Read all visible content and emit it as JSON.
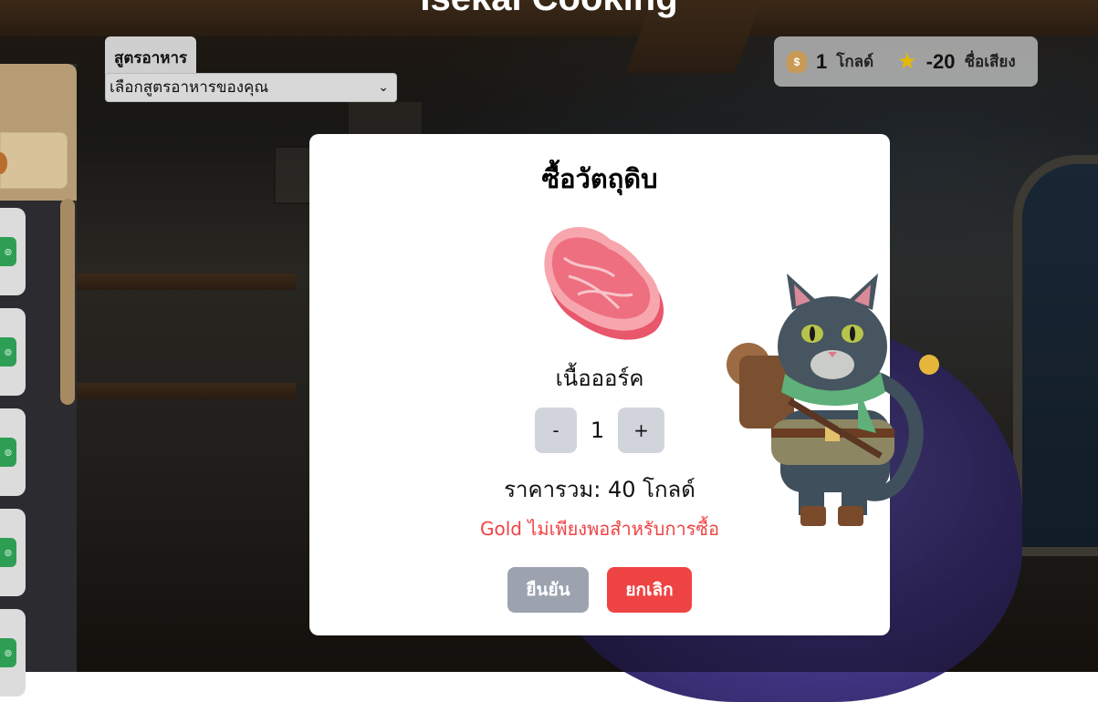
{
  "game_title": "Isekai Cooking",
  "recipe": {
    "label": "สูตรอาหาร",
    "selected": "เลือกสูตรอาหารของคุณ"
  },
  "stats": {
    "gold_value": "1",
    "gold_unit": "โกลด์",
    "gold_icon": "money-bag-icon",
    "reputation_value": "-20",
    "reputation_unit": "ชื่อเสียง",
    "reputation_icon": "star-icon"
  },
  "sidebar": {
    "card_buttons": [
      "๏",
      "๏",
      "๏",
      "๏",
      "๏"
    ]
  },
  "modal": {
    "title": "ซื้อวัตถุดิบ",
    "item_name": "เนื้อออร์ค",
    "item_icon": "meat-steak-icon",
    "minus_label": "-",
    "quantity": "1",
    "plus_label": "+",
    "total": "ราคารวม: 40 โกลด์",
    "warning": "Gold ไม่เพียงพอสำหรับการซื้อ",
    "confirm_label": "ยืนยัน",
    "cancel_label": "ยกเลิก"
  },
  "colors": {
    "warning": "#ef4444",
    "cancel": "#ef4444",
    "confirm_disabled": "#9ca3af",
    "quantity_button": "#d1d5db"
  }
}
